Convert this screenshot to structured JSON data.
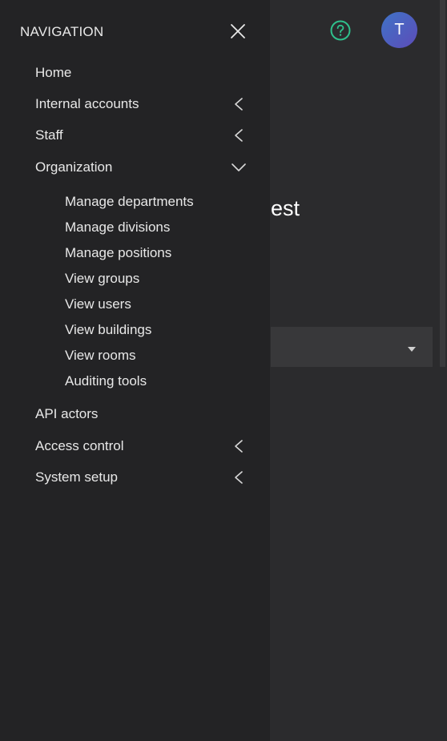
{
  "header": {
    "help_icon": "help-circle-icon",
    "avatar_initial": "T",
    "accent_color": "#2fc08c"
  },
  "main": {
    "heading_fragment": "est"
  },
  "drawer": {
    "title": "NAVIGATION",
    "close_icon": "close-icon",
    "items": [
      {
        "label": "Home",
        "chevron": "none"
      },
      {
        "label": "Internal accounts",
        "chevron": "left"
      },
      {
        "label": "Staff",
        "chevron": "left"
      },
      {
        "label": "Organization",
        "chevron": "down",
        "expanded": true
      },
      {
        "label": "API actors",
        "chevron": "none"
      },
      {
        "label": "Access control",
        "chevron": "left"
      },
      {
        "label": "System setup",
        "chevron": "left"
      }
    ],
    "organization_subitems": [
      "Manage departments",
      "Manage divisions",
      "Manage positions",
      "View groups",
      "View users",
      "View buildings",
      "View rooms",
      "Auditing tools"
    ]
  }
}
